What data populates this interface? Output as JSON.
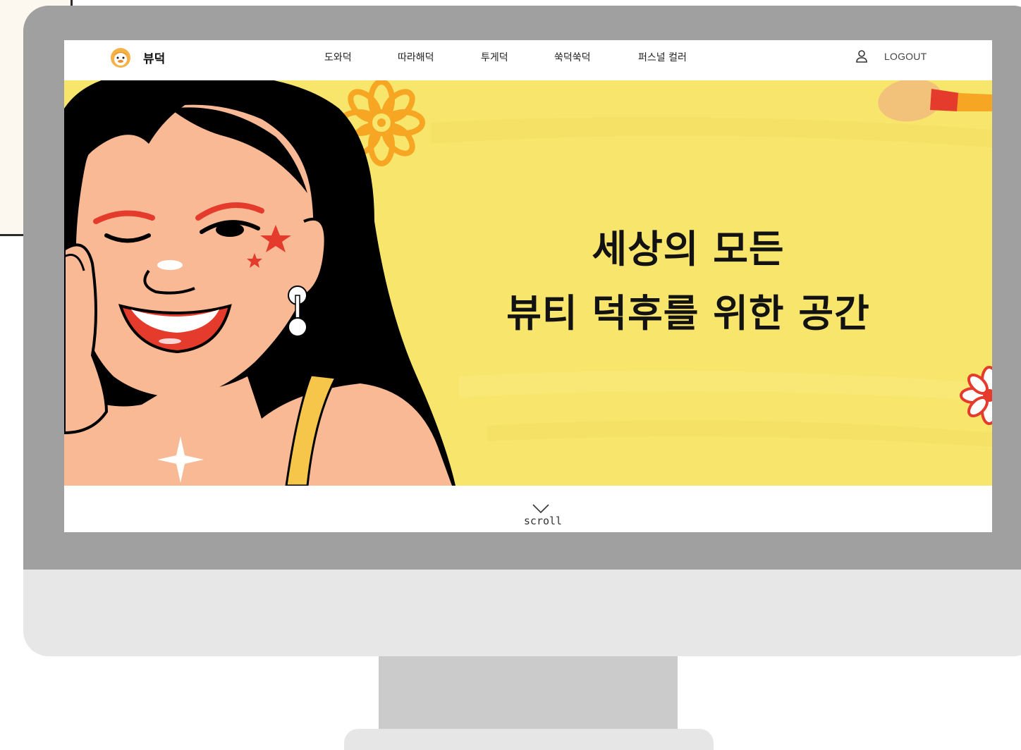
{
  "nav": {
    "brand": "뷰덕",
    "items": [
      {
        "label": "도와덕"
      },
      {
        "label": "따라해덕"
      },
      {
        "label": "투게덕"
      },
      {
        "label": "쑥덕쑥덕"
      },
      {
        "label": "퍼스널 컬러"
      }
    ],
    "logout_label": "LOGOUT"
  },
  "hero": {
    "line1": "세상의 모든",
    "line2": "뷰티 덕후를 위한 공간"
  },
  "scroll": {
    "label": "scroll"
  },
  "colors": {
    "hero_bg": "#f8e56c",
    "skin": "#f9b994",
    "hair": "#000000",
    "accent_red": "#e53b2c",
    "flower_orange": "#f6a623",
    "bezel": "#a0a0a0",
    "chin": "#e7e7e7",
    "stand": "#cbcbcb"
  }
}
